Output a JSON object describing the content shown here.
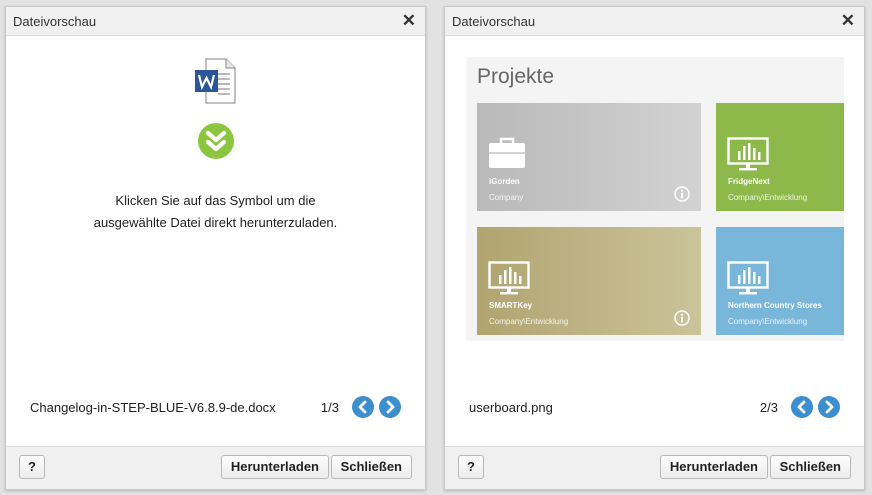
{
  "dialog_left": {
    "title": "Dateivorschau",
    "close_glyph": "✕",
    "message_line1": "Klicken Sie auf das Symbol um die",
    "message_line2": "ausgewählte Datei direkt herunterzuladen.",
    "icons": [
      "word-document-icon",
      "download-chevron-icon"
    ],
    "file_name": "Changelog-in-STEP-BLUE-V6.8.9-de.docx",
    "counter": "1/3",
    "help_label": "?",
    "download_label": "Herunterladen",
    "close_label": "Schließen"
  },
  "dialog_right": {
    "title": "Dateivorschau",
    "close_glyph": "✕",
    "preview": {
      "heading": "Projekte",
      "tiles": [
        {
          "name": "iGorden",
          "subtitle": "Company",
          "icon": "briefcase-icon",
          "color": "#c4c4c4"
        },
        {
          "name": "FridgeNext",
          "subtitle": "Company\\Entwicklung",
          "icon": "monitor-chart-icon",
          "color": "#8db84a"
        },
        {
          "name": "SMARTKey",
          "subtitle": "Company\\Entwicklung",
          "icon": "monitor-chart-icon",
          "color": "#bdb385"
        },
        {
          "name": "Northern Country Stores",
          "subtitle": "Company\\Entwicklung",
          "icon": "monitor-chart-icon",
          "color": "#78b6da"
        }
      ]
    },
    "file_name": "userboard.png",
    "counter": "2/3",
    "help_label": "?",
    "download_label": "Herunterladen",
    "close_label": "Schließen"
  },
  "colors": {
    "nav_button": "#3b8fcf",
    "download_icon": "#8cc63f",
    "word_blue": "#2b579a"
  }
}
